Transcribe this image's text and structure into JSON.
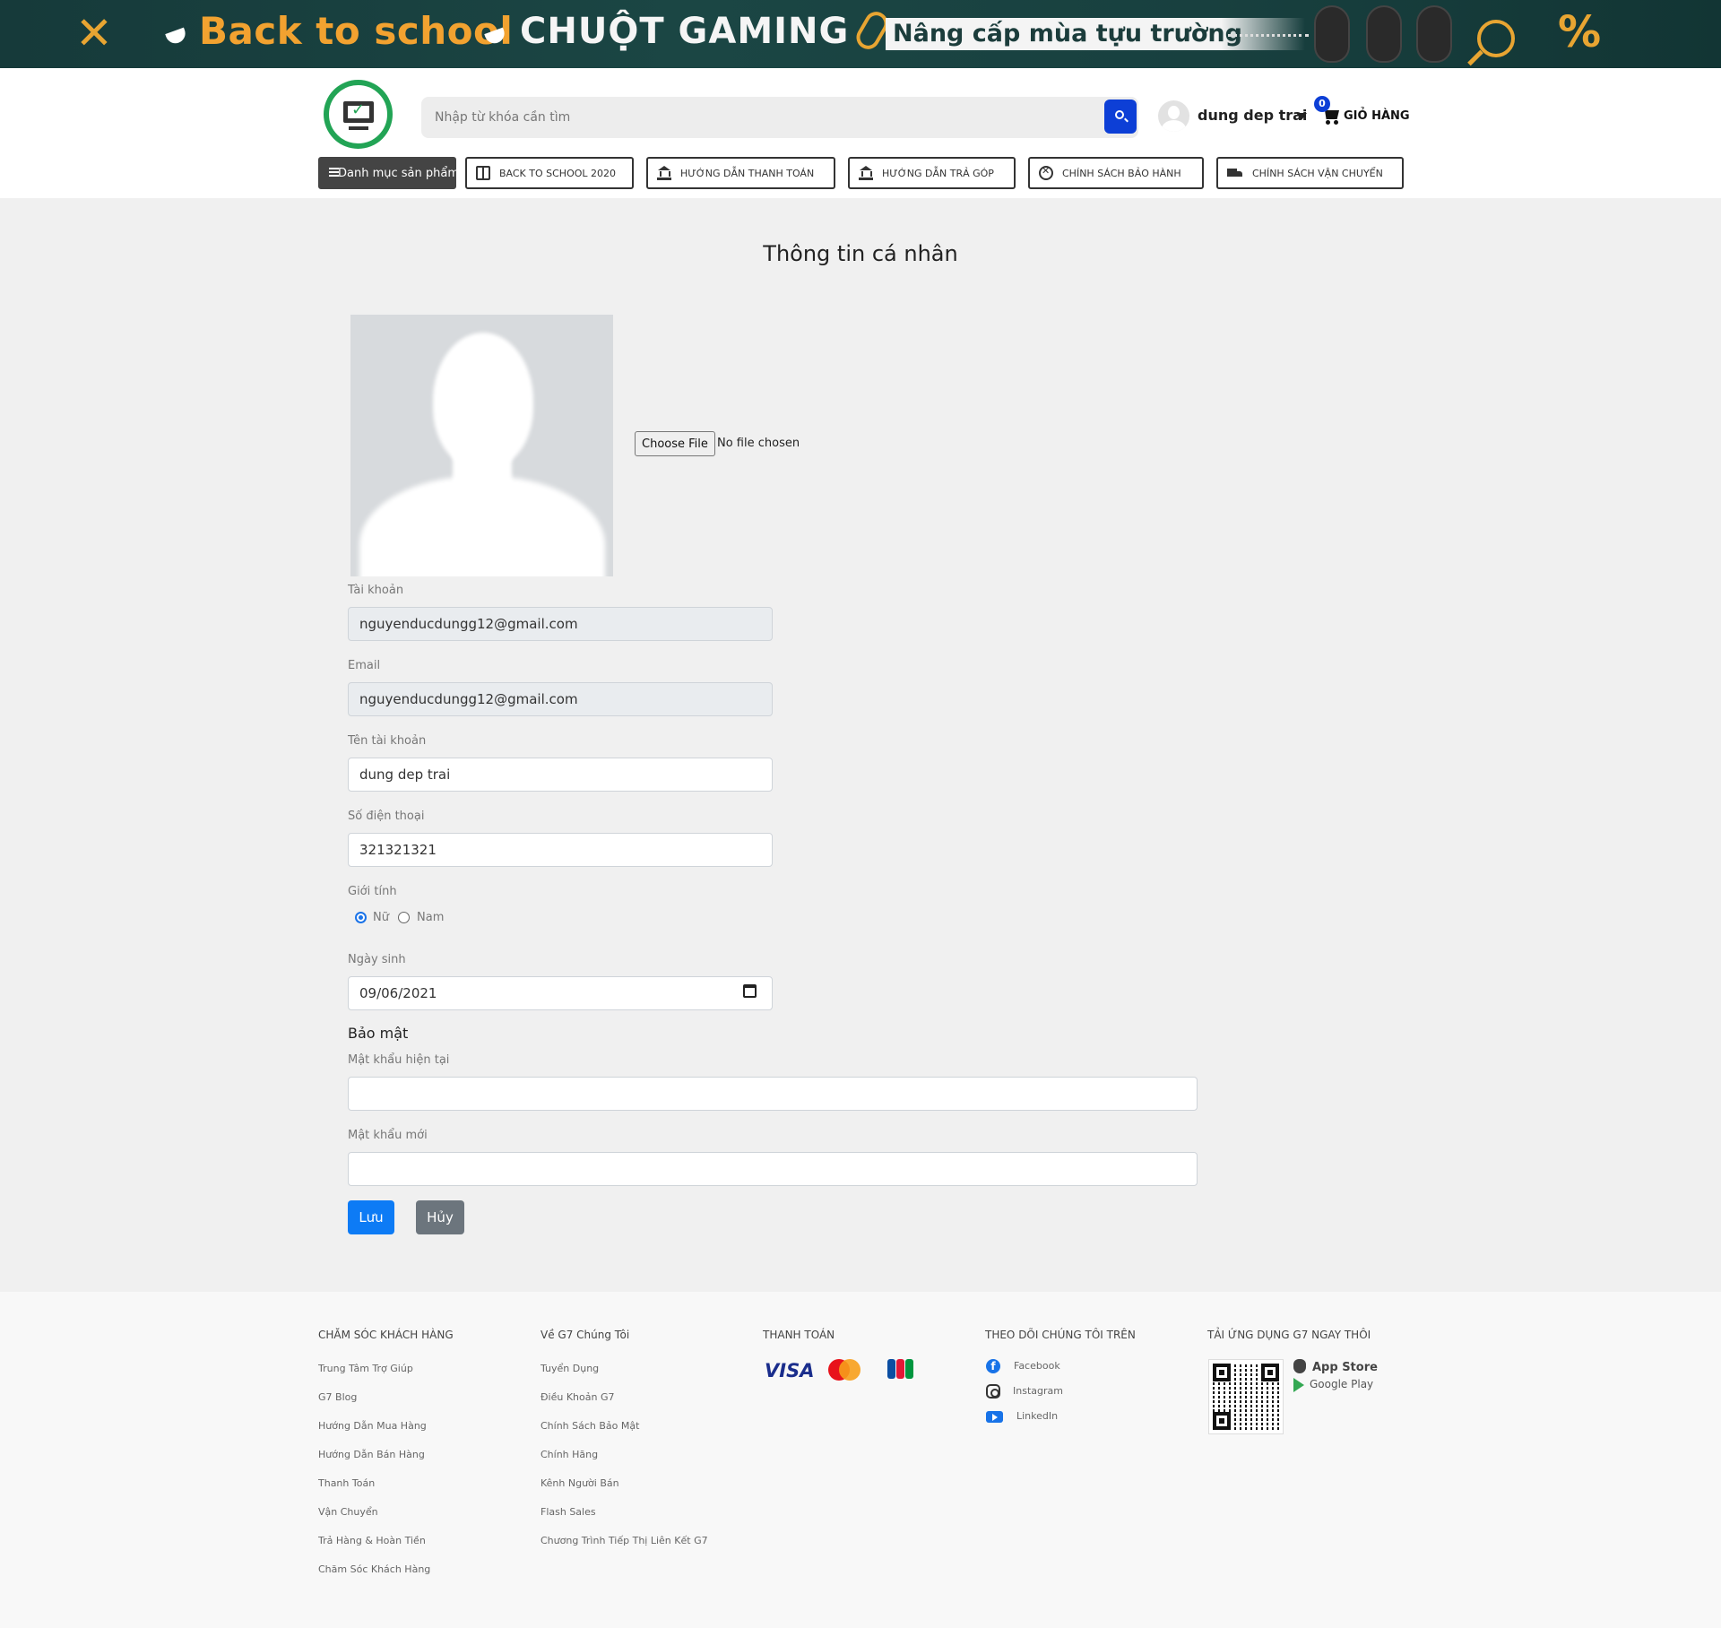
{
  "banner": {
    "headline": "Back to school",
    "product": "CHUỘT GAMING",
    "tagline": "Nâng cấp mùa tựu trường"
  },
  "header": {
    "search_placeholder": "Nhập từ khóa cần tìm",
    "user_name": "dung dep trai",
    "cart_count": "0",
    "cart_label": "GIỎ HÀNG"
  },
  "nav": {
    "category": "Danh mục sản phẩm",
    "items": [
      {
        "label": "BACK TO SCHOOL 2020",
        "icon": "gift-box-icon"
      },
      {
        "label": "HƯỚNG DẪN THANH TOÁN",
        "icon": "bank-icon"
      },
      {
        "label": "HƯỚNG DẪN TRẢ GÓP",
        "icon": "bank-icon"
      },
      {
        "label": "CHÍNH SÁCH BẢO HÀNH",
        "icon": "tools-icon"
      },
      {
        "label": "CHÍNH SÁCH VẬN CHUYỂN",
        "icon": "truck-icon"
      }
    ]
  },
  "profile": {
    "title": "Thông tin cá nhân",
    "file_button": "Choose File",
    "file_status": "No file chosen",
    "account_label": "Tài khoản",
    "account_value": "nguyenducdungg12@gmail.com",
    "email_label": "Email",
    "email_value": "nguyenducdungg12@gmail.com",
    "username_label": "Tên tài khoản",
    "username_value": "dung dep trai",
    "phone_label": "Số điện thoại",
    "phone_value": "321321321",
    "gender_label": "Giới tính",
    "gender_female": "Nữ",
    "gender_male": "Nam",
    "gender_selected": "Nữ",
    "dob_label": "Ngày sinh",
    "dob_value": "09/06/2021",
    "security_title": "Bảo mật",
    "current_password_label": "Mật khẩu hiện tại",
    "new_password_label": "Mật khẩu mới",
    "save_label": "Lưu",
    "cancel_label": "Hủy"
  },
  "footer": {
    "col1": {
      "title": "CHĂM SÓC KHÁCH HÀNG",
      "links": [
        "Trung Tâm Trợ Giúp",
        "G7 Blog",
        "Hướng Dẫn Mua Hàng",
        "Hướng Dẫn Bán Hàng",
        "Thanh Toán",
        "Vận Chuyển",
        "Trả Hàng & Hoàn Tiền",
        "Chăm Sóc Khách Hàng"
      ]
    },
    "col2": {
      "title": "Về G7 Chúng Tôi",
      "links": [
        "Tuyển Dụng",
        "Điều Khoản G7",
        "Chính Sách Bảo Mật",
        "Chính Hãng",
        "Kênh Người Bán",
        "Flash Sales",
        "Chương Trình Tiếp Thị Liên Kết G7"
      ]
    },
    "col3": {
      "title": "THANH TOÁN",
      "visa": "VISA"
    },
    "col4": {
      "title": "THEO DÕI CHÚNG TÔI TRÊN",
      "links": [
        "Facebook",
        "Instagram",
        "LinkedIn"
      ]
    },
    "col5": {
      "title": "TẢI ỨNG DỤNG G7 NGAY THÔI",
      "app_store": "App Store",
      "google_play": "Google Play"
    }
  },
  "colors": {
    "brand_blue": "#0d3fd6",
    "save_blue": "#0d7bf5",
    "logo_green": "#22a455",
    "banner_orange": "#f2a230"
  }
}
